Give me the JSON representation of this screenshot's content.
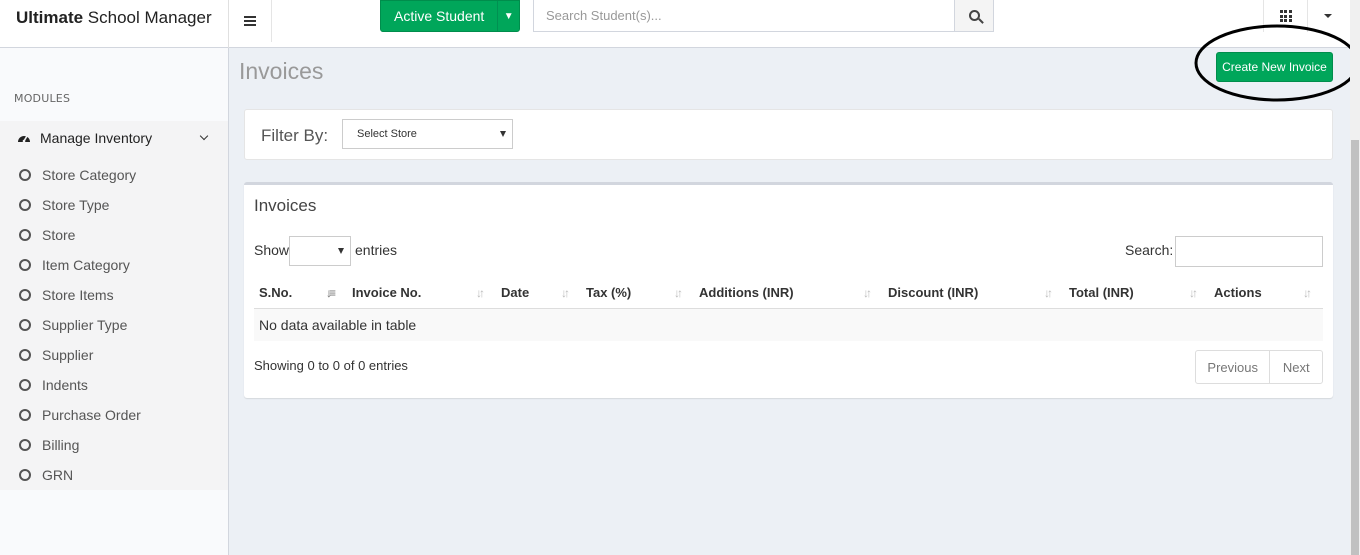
{
  "brand": {
    "bold": "Ultimate",
    "rest": " School Manager"
  },
  "topbar": {
    "active_button": "Active Student",
    "search_placeholder": "Search Student(s)..."
  },
  "sidebar": {
    "header": "MODULES",
    "parent": "Manage Inventory",
    "items": [
      {
        "label": "Store Category"
      },
      {
        "label": "Store Type"
      },
      {
        "label": "Store"
      },
      {
        "label": "Item Category"
      },
      {
        "label": "Store Items"
      },
      {
        "label": "Supplier Type"
      },
      {
        "label": "Supplier"
      },
      {
        "label": "Indents"
      },
      {
        "label": "Purchase Order"
      },
      {
        "label": "Billing"
      },
      {
        "label": "GRN"
      }
    ]
  },
  "page": {
    "title": "Invoices",
    "create_button": "Create New Invoice"
  },
  "filter": {
    "label": "Filter By:",
    "store_select": "Select Store"
  },
  "table_box": {
    "title": "Invoices",
    "show_label": "Show",
    "entries_label": "entries",
    "search_label": "Search:",
    "columns": [
      "S.No.",
      "Invoice No.",
      "Date",
      "Tax (%)",
      "Additions (INR)",
      "Discount (INR)",
      "Total (INR)",
      "Actions"
    ],
    "empty_message": "No data available in table",
    "info": "Showing 0 to 0 of 0 entries",
    "prev": "Previous",
    "next": "Next"
  },
  "colors": {
    "accent_green": "#00a65a",
    "content_bg": "#ecf0f5"
  }
}
